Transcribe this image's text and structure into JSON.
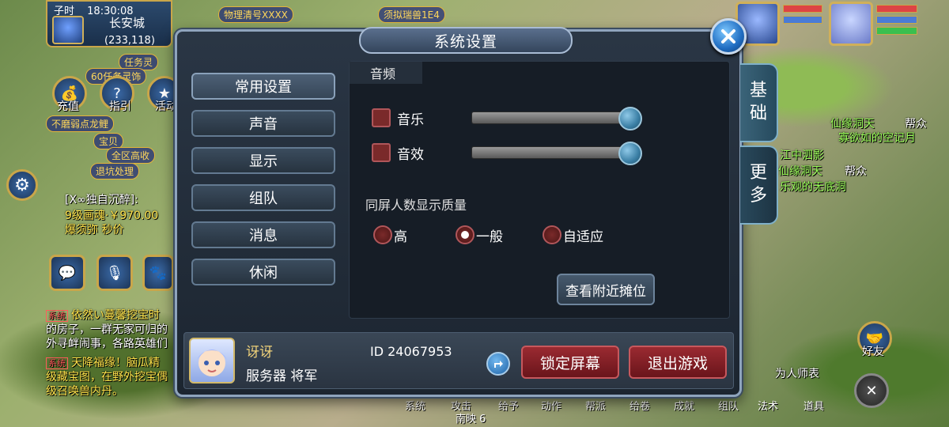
{
  "hud": {
    "shichen": "子时",
    "time": "18:30:08",
    "city": "长安城",
    "coords": "(233,118)",
    "bubbles": [
      "物理清号XXXX",
      "须拟瑞兽1E4",
      "任务灵",
      "60任务灵饰"
    ],
    "left_icons": {
      "recharge": "充值",
      "guide": "指引",
      "activity": "活动"
    },
    "left_banners": [
      "不磨弱点龙鲤",
      "宝贝",
      "全区高收",
      "退坑处理"
    ],
    "chat": [
      {
        "text": "[X∞独自沉醉]:",
        "class": ""
      },
      {
        "text": "9级画魂·￥970.00",
        "class": "yellow"
      },
      {
        "text": "爆须弥 秒价",
        "class": "yellow"
      },
      {
        "tag": "系统",
        "text": "依然い蔓馨挖宝时",
        "class": "yellow"
      },
      {
        "text": "的房子，一群无家可归的",
        "class": ""
      },
      {
        "text": "外寻衅闹事，各路英雄们",
        "class": ""
      },
      {
        "tag": "系统",
        "text": "天降福缘！脑瓜精",
        "class": "yellow"
      },
      {
        "text": "级藏宝图，在野外挖宝偶",
        "class": ""
      },
      {
        "text": "级召唤兽内丹。",
        "class": ""
      }
    ],
    "right_map_text": [
      "仙缘洞天",
      "帮众",
      "寡欲如的空记月",
      "江中泗影",
      "仙缘洞天",
      "帮众",
      "乐观的无底洞"
    ],
    "friends_label": "好友",
    "master_label": "为人师表",
    "bottom_menu": [
      "系统",
      "攻击",
      "给予",
      "动作",
      "帮派",
      "给卷",
      "成就",
      "组队",
      "法术",
      "道具"
    ],
    "bottom_extra": "南映 6"
  },
  "dialog": {
    "title": "系统设置",
    "side_tabs": [
      {
        "label_lines": [
          "基",
          "础"
        ],
        "active": true
      },
      {
        "label_lines": [
          "更",
          "多"
        ],
        "active": false
      }
    ],
    "nav": [
      {
        "label": "常用设置",
        "active": true
      },
      {
        "label": "声音",
        "active": false
      },
      {
        "label": "显示",
        "active": false
      },
      {
        "label": "组队",
        "active": false
      },
      {
        "label": "消息",
        "active": false
      },
      {
        "label": "休闲",
        "active": false
      }
    ],
    "audio": {
      "heading": "音频",
      "music": {
        "label": "音乐",
        "level": 1.0
      },
      "sfx": {
        "label": "音效",
        "level": 1.0
      }
    },
    "display_quality": {
      "title": "同屏人数显示质量",
      "options": [
        {
          "label": "高",
          "selected": false
        },
        {
          "label": "一般",
          "selected": true
        },
        {
          "label": "自适应",
          "selected": false
        }
      ]
    },
    "nearby_stalls_button": "查看附近摊位",
    "profile": {
      "name": "讶讶",
      "server": "服务器 将军",
      "id": "ID 24067953"
    },
    "lock_screen_button": "锁定屏幕",
    "exit_game_button": "退出游戏"
  }
}
